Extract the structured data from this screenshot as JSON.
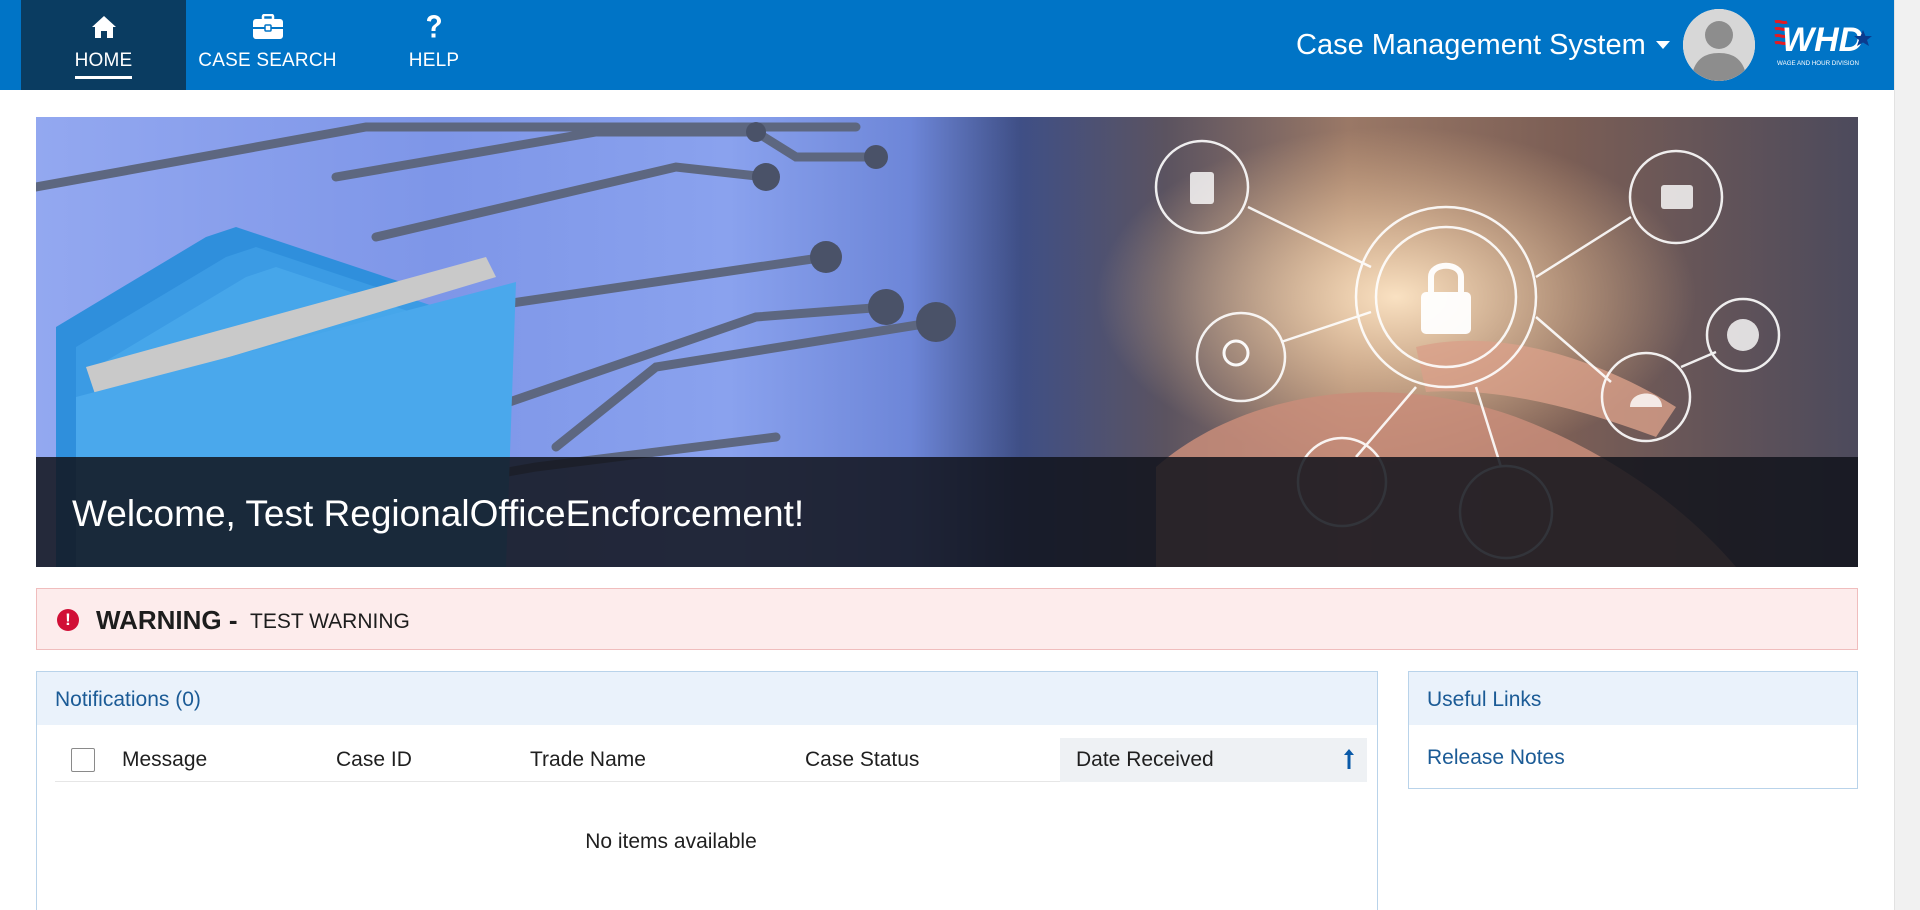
{
  "nav": {
    "items": [
      {
        "label": "HOME",
        "icon": "home-icon",
        "active": true
      },
      {
        "label": "CASE SEARCH",
        "icon": "briefcase-icon",
        "active": false
      },
      {
        "label": "HELP",
        "icon": "question-icon",
        "active": false
      }
    ]
  },
  "header": {
    "app_title": "Case Management System",
    "logo_text": "WHD",
    "logo_subtext": "WAGE AND HOUR DIVISION"
  },
  "hero": {
    "welcome": "Welcome, Test RegionalOfficeEncforcement!"
  },
  "warning": {
    "title": "WARNING -",
    "message": "TEST WARNING",
    "icon": "exclamation-circle-icon"
  },
  "notifications": {
    "title": "Notifications (0)",
    "columns": [
      "Message",
      "Case ID",
      "Trade Name",
      "Case Status",
      "Date Received"
    ],
    "sorted_column": "Date Received",
    "sort_direction": "ascending",
    "empty_text": "No items available"
  },
  "useful_links": {
    "title": "Useful Links",
    "links": [
      "Release Notes"
    ]
  },
  "colors": {
    "topbar": "#0074c6",
    "active_nav": "#0a3c61",
    "link": "#1b5b96",
    "warning_bg": "#fdecec",
    "warning_icon": "#d10f36"
  }
}
